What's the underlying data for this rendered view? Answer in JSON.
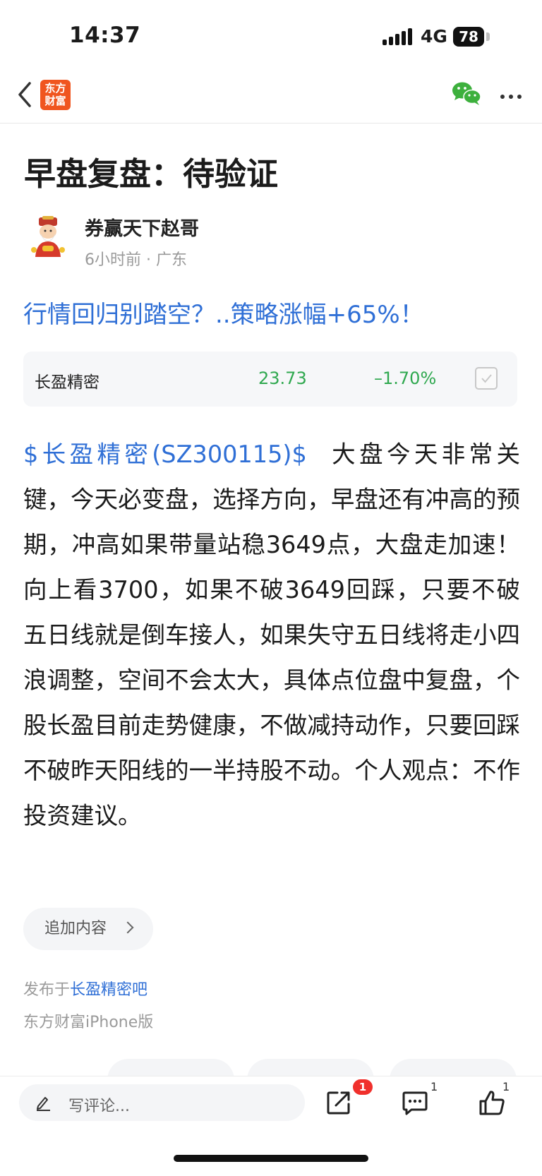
{
  "status_bar": {
    "time": "14:37",
    "network": "4G",
    "battery": "78"
  },
  "nav": {
    "logo_line1": "东方",
    "logo_line2": "财富"
  },
  "article": {
    "title": "早盘复盘：待验证",
    "author": "券赢天下赵哥",
    "meta": "6小时前 · 广东",
    "promo": "行情回归别踏空？..策略涨幅+65%！",
    "stock": {
      "name": "长盈精密",
      "price": "23.73",
      "change": "–1.70%"
    },
    "stock_link": "$长盈精密(SZ300115)$",
    "body": "大盘今天非常关键，今天必变盘，选择方向，早盘还有冲高的预期，冲高如果带量站稳3649点，大盘走加速！向上看3700，如果不破3649回踩，只要不破五日线就是倒车接人，如果失守五日线将走小四浪调整，空间不会太大，具体点位盘中复盘，个股长盈目前走势健康，不做减持动作，只要回踩不破昨天阳线的一半持股不动。个人观点：不作投资建议。",
    "add_content": "追加内容",
    "published_prefix": "发布于",
    "published_bar": "长盈精密吧",
    "client": "东方财富iPhone版"
  },
  "bottom_bar": {
    "comment_placeholder": "写评论...",
    "share_badge": "1",
    "comment_count": "1",
    "like_count": "1"
  },
  "colors": {
    "accent": "#2f6fd6",
    "down_green": "#2fa84f",
    "brand_orange": "#f0551f",
    "badge_red": "#f0302c"
  },
  "icons": [
    "back-icon",
    "wechat-icon",
    "more-icon",
    "checkbox-icon",
    "pencil-icon",
    "share-icon",
    "comment-icon",
    "like-icon"
  ]
}
